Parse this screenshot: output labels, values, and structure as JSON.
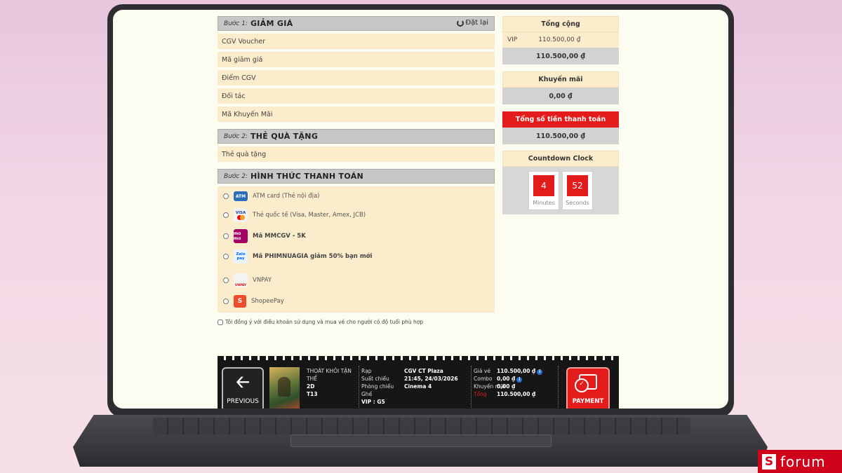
{
  "step1": {
    "step_no": "Bước 1:",
    "title": "GIẢM GIÁ",
    "reset_label": "Đặt lại",
    "items": [
      "CGV Voucher",
      "Mã giảm giá",
      "Điểm CGV",
      "Đối tác",
      "Mã Khuyến Mãi"
    ]
  },
  "step2_gift": {
    "step_no": "Bước 2:",
    "title": "THẺ QUÀ TẶNG",
    "items": [
      "Thẻ quà tặng"
    ]
  },
  "step2_payment": {
    "step_no": "Bước 2:",
    "title": "HÌNH THỨC THANH TOÁN",
    "methods": [
      {
        "logo": "ATM",
        "label": "ATM card (Thẻ nội địa)",
        "color": "#2a6fb8"
      },
      {
        "logo": "VISA",
        "label": "Thẻ quốc tế (Visa, Master, Amex, JCB)",
        "color": "#f3f3f3"
      },
      {
        "logo": "mo mo",
        "label": "Mã MMCGV - 5K",
        "color": "#a50064"
      },
      {
        "logo": "Zalo pay",
        "label": "Mã PHIMNUAGIA giảm 50% bạn mới",
        "color": "#e8f4ff"
      },
      {
        "logo": "VNPAY",
        "label": "VNPAY",
        "color": "#f3f3f3"
      },
      {
        "logo": "S",
        "label": "ShopeePay",
        "color": "#ee4d2d"
      }
    ]
  },
  "agree_text": "Tôi đồng ý với điều khoản sử dụng và mua vé cho người có độ tuổi phù hợp",
  "summary": {
    "total_title": "Tổng cộng",
    "seat_type": "VIP",
    "seat_price": "110.500,00 ₫",
    "total": "110.500,00 ₫",
    "promo_title": "Khuyến mãi",
    "promo_value": "0,00 ₫",
    "pay_title": "Tổng số tiền thanh toán",
    "pay_value": "110.500,00 ₫"
  },
  "countdown": {
    "title": "Countdown Clock",
    "minutes": "4",
    "minutes_label": "Minutes",
    "seconds": "52",
    "seconds_label": "Seconds"
  },
  "ticket": {
    "previous_label": "PREVIOUS",
    "movie_title": "THOÁT KHỎI TẬN THẾ",
    "format": "2D",
    "rating": "T13",
    "labels": {
      "cinema": "Rạp",
      "showtime": "Suất chiếu",
      "room": "Phòng chiếu",
      "seat": "Ghế"
    },
    "cinema": "CGV CT Plaza",
    "showtime": "21:45, 24/03/2026",
    "room": "Cinema 4",
    "seat": "VIP : G5",
    "price_labels": {
      "ticket": "Giá vé",
      "combo": "Combo",
      "promo": "Khuyến mãi",
      "total": "Tổng"
    },
    "ticket_price": "110.500,00 ₫",
    "combo_price": "0,00 ₫",
    "promo_price": "0,00 ₫",
    "total_price": "110.500,00 ₫",
    "payment_label": "PAYMENT"
  },
  "watermark": {
    "letter": "S",
    "text": "forum"
  },
  "colors": {
    "accent_red": "#e31b1b",
    "row_bg": "#fbeccb",
    "header_gray": "#c7c7c7"
  }
}
